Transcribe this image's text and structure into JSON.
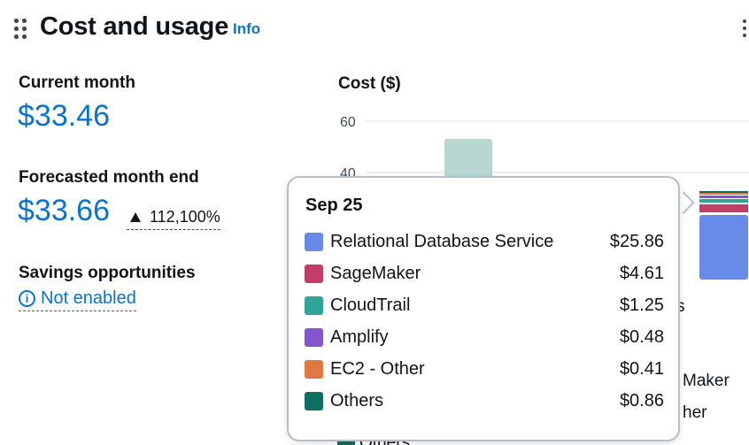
{
  "header": {
    "title": "Cost and usage",
    "info_label": "Info"
  },
  "summary": {
    "current_month_label": "Current month",
    "current_month_value": "$33.46",
    "forecast_label": "Forecasted month end",
    "forecast_value": "$33.66",
    "forecast_change": "112,100%",
    "savings_label": "Savings opportunities",
    "savings_status": "Not enabled"
  },
  "icons": {
    "drag": "drag-handle-icon",
    "menu": "kebab-menu-icon",
    "trend": "triangle-up-icon",
    "info": "info-circle-icon"
  },
  "chart_data": {
    "type": "bar",
    "ylabel": "Cost ($)",
    "y_ticks": [
      "60",
      "40"
    ],
    "visible_partial_labels": [
      "s",
      "Maker",
      "her",
      "Others"
    ]
  },
  "tooltip": {
    "date": "Sep 25",
    "rows": [
      {
        "name": "Relational Database Service",
        "value": "$25.86",
        "color": "#688ae8"
      },
      {
        "name": "SageMaker",
        "value": "$4.61",
        "color": "#c33d69"
      },
      {
        "name": "CloudTrail",
        "value": "$1.25",
        "color": "#2ea597"
      },
      {
        "name": "Amplify",
        "value": "$0.48",
        "color": "#8456ce"
      },
      {
        "name": "EC2 - Other",
        "value": "$0.41",
        "color": "#e07941"
      },
      {
        "name": "Others",
        "value": "$0.86",
        "color": "#0f6e63"
      }
    ]
  }
}
